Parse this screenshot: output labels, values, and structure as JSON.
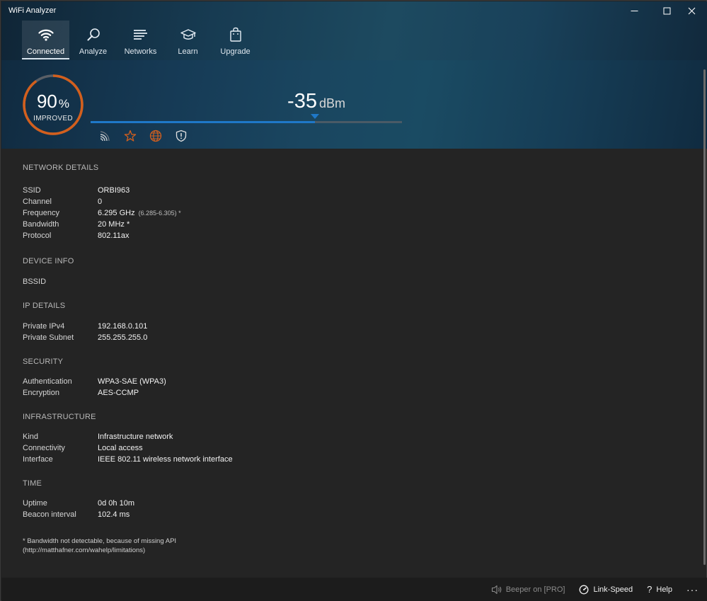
{
  "app": {
    "title": "WiFi Analyzer"
  },
  "window_controls": {
    "minimize": "—",
    "maximize": "☐",
    "close": "✕"
  },
  "nav": [
    {
      "label": "Connected",
      "icon": "wifi-icon",
      "active": true
    },
    {
      "label": "Analyze",
      "icon": "magnifier-icon",
      "active": false
    },
    {
      "label": "Networks",
      "icon": "networks-list-icon",
      "active": false
    },
    {
      "label": "Learn",
      "icon": "graduation-cap-icon",
      "active": false
    },
    {
      "label": "Upgrade",
      "icon": "shopping-bag-icon",
      "active": false
    }
  ],
  "gauge": {
    "value": "90",
    "unit": "%",
    "label": "IMPROVED",
    "fraction": 0.9
  },
  "signal": {
    "value": "-35",
    "unit": "dBm",
    "level_fraction": 0.72
  },
  "status_icons": [
    "signal-strength-icon",
    "star-icon",
    "globe-icon",
    "shield-icon"
  ],
  "colors": {
    "accent_orange": "#d35f1d",
    "signal_blue": "#1f78c8"
  },
  "sections": {
    "network": {
      "title": "NETWORK DETAILS",
      "rows": [
        {
          "k": "SSID",
          "v": "ORBI963"
        },
        {
          "k": "Channel",
          "v": "0"
        },
        {
          "k": "Frequency",
          "v": "6.295 GHz",
          "sub": "(6.285-6.305) *"
        },
        {
          "k": "Bandwidth",
          "v": "20 MHz *"
        },
        {
          "k": "Protocol",
          "v": "802.11ax"
        }
      ]
    },
    "device": {
      "title": "DEVICE INFO",
      "rows": [
        {
          "k": "BSSID",
          "v": ""
        }
      ]
    },
    "ip": {
      "title": "IP DETAILS",
      "rows": [
        {
          "k": "Private IPv4",
          "v": "192.168.0.101"
        },
        {
          "k": "Private Subnet",
          "v": "255.255.255.0"
        }
      ]
    },
    "security": {
      "title": "SECURITY",
      "rows": [
        {
          "k": "Authentication",
          "v": "WPA3-SAE (WPA3)"
        },
        {
          "k": "Encryption",
          "v": "AES-CCMP"
        }
      ]
    },
    "infrastructure": {
      "title": "INFRASTRUCTURE",
      "rows": [
        {
          "k": "Kind",
          "v": "Infrastructure network"
        },
        {
          "k": "Connectivity",
          "v": "Local access"
        },
        {
          "k": "Interface",
          "v": "IEEE 802.11 wireless network interface"
        }
      ]
    },
    "time": {
      "title": "TIME",
      "rows": [
        {
          "k": "Uptime",
          "v": "0d 0h 10m"
        },
        {
          "k": "Beacon interval",
          "v": "102.4 ms"
        }
      ]
    }
  },
  "footnote": {
    "line1": "* Bandwidth not detectable, because of missing API",
    "line2": "(http://matthafner.com/wahelp/limitations)"
  },
  "bottombar": {
    "beeper": "Beeper on [PRO]",
    "link_speed": "Link-Speed",
    "help": "Help",
    "more": "···"
  }
}
